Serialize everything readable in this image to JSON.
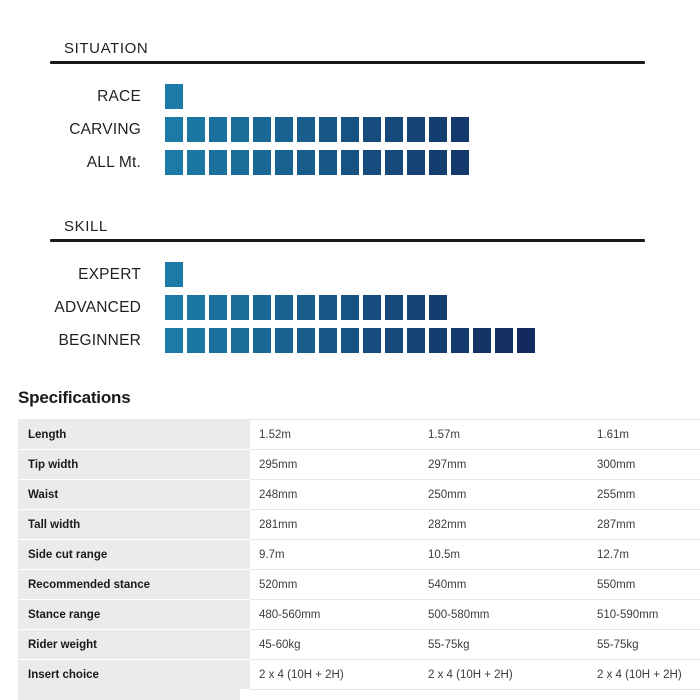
{
  "sections": [
    {
      "id": "situation",
      "title": "SITUATION",
      "rows": [
        {
          "label": "RACE",
          "count": 1
        },
        {
          "label": "CARVING",
          "count": 14
        },
        {
          "label": "ALL Mt.",
          "count": 14
        }
      ]
    },
    {
      "id": "skill",
      "title": "SKILL",
      "rows": [
        {
          "label": "EXPERT",
          "count": 1
        },
        {
          "label": "ADVANCED",
          "count": 13
        },
        {
          "label": "BEGINNER",
          "count": 17
        }
      ]
    }
  ],
  "colors": {
    "bar_start": "#1b7ba6",
    "bar_end": "#132a5e",
    "rule": "#1a1a1a",
    "label_cell_bg": "#ebebeb",
    "text": "#231f20"
  },
  "specifications": {
    "heading": "Specifications",
    "rows": [
      {
        "label": "Length",
        "values": [
          "1.52m",
          "1.57m",
          "1.61m"
        ]
      },
      {
        "label": "Tip width",
        "values": [
          "295mm",
          "297mm",
          "300mm"
        ]
      },
      {
        "label": "Waist",
        "values": [
          "248mm",
          "250mm",
          "255mm"
        ]
      },
      {
        "label": "Tall width",
        "values": [
          "281mm",
          "282mm",
          "287mm"
        ]
      },
      {
        "label": "Side cut range",
        "values": [
          "9.7m",
          "10.5m",
          "12.7m"
        ]
      },
      {
        "label": "Recommended stance",
        "values": [
          "520mm",
          "540mm",
          "550mm"
        ]
      },
      {
        "label": "Stance range",
        "values": [
          "480-560mm",
          "500-580mm",
          "510-590mm"
        ]
      },
      {
        "label": "Rider weight",
        "values": [
          "45-60kg",
          "55-75kg",
          "55-75kg"
        ]
      },
      {
        "label": "Insert choice",
        "values": [
          "2 x 4 (10H + 2H)",
          "2 x 4 (10H + 2H)",
          "2 x 4 (10H + 2H)"
        ]
      }
    ]
  }
}
